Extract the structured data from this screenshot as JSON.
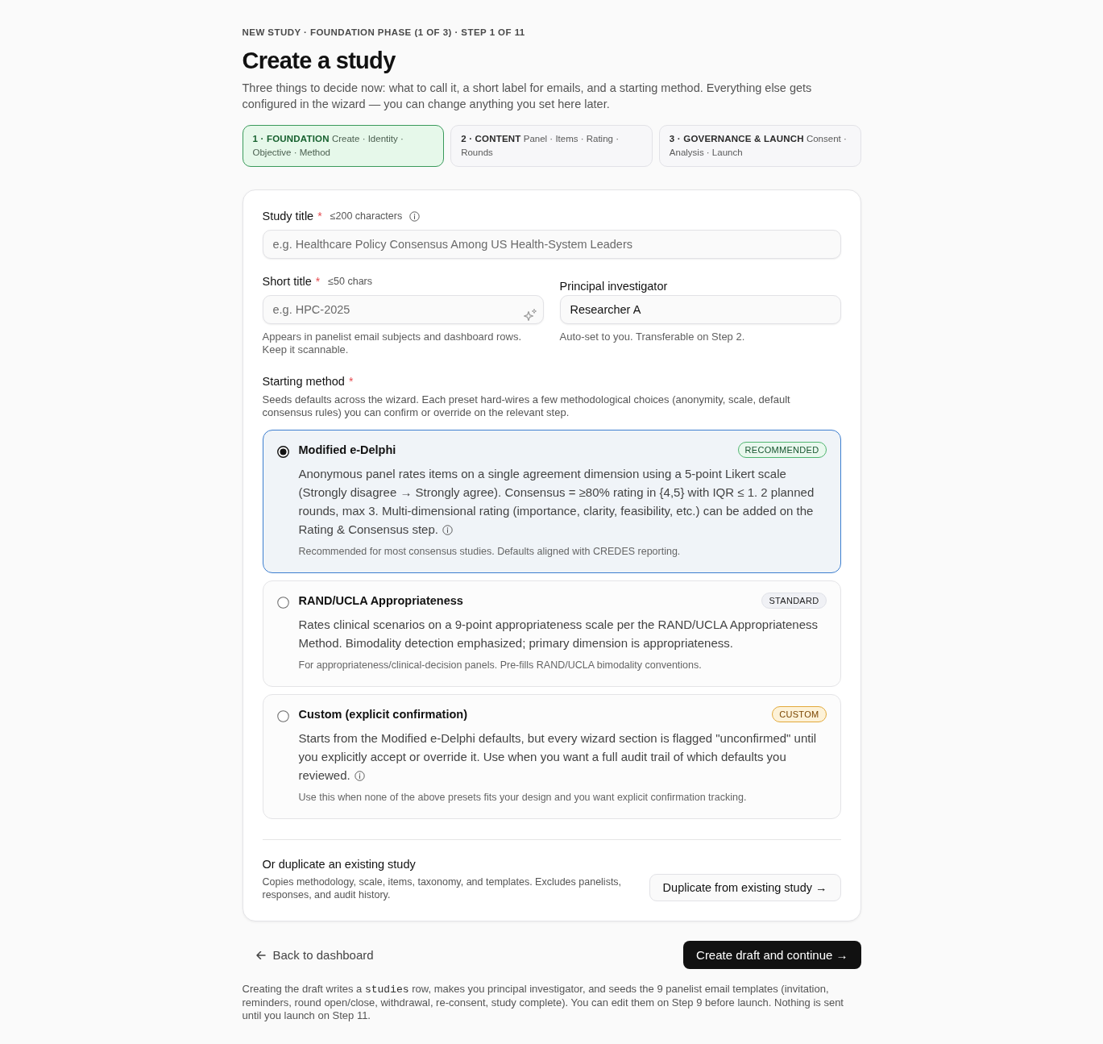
{
  "breadcrumb": "NEW STUDY · FOUNDATION PHASE (1 OF 3) · STEP 1 OF 11",
  "title": "Create a study",
  "intro": "Three things to decide now: what to call it, a short label for emails, and a starting method. Everything else gets configured in the wizard — you can change anything you set here later.",
  "phases": [
    {
      "text": "**1 · FOUNDATION** Create · Identity · Objective · Method",
      "selected": true
    },
    {
      "text": "**2 · CONTENT** Panel · Items · Rating · Rounds",
      "selected": false
    },
    {
      "text": "**3 · GOVERNANCE & LAUNCH** Consent · Analysis · Launch",
      "selected": false
    }
  ],
  "study_title": {
    "label": "Study title",
    "required_mark": "*",
    "hint": "≤200 characters",
    "info": true,
    "placeholder": "e.g. Healthcare Policy Consensus Among US Health-System Leaders"
  },
  "short_title": {
    "label": "Short title",
    "required_mark": "*",
    "hint": "≤50 chars",
    "placeholder": "e.g. HPC-2025",
    "help": "Appears in panelist email subjects and dashboard rows. Keep it scannable."
  },
  "principal_investigator": {
    "label": "Principal investigator",
    "value": "Researcher A",
    "help": "Auto-set to you. Transferable on Step 2."
  },
  "starting_method": {
    "label": "Starting method",
    "required_mark": "*",
    "description": "Seeds defaults across the wizard. Each preset hard-wires a few methodological choices (anonymity, scale, default consensus rules) you can confirm or override on the relevant step.",
    "options": [
      {
        "title": "Modified e-Delphi",
        "badge": {
          "text": "RECOMMENDED",
          "kind": "recommended"
        },
        "description": "Anonymous panel rates items on a single agreement dimension using a 5-point Likert scale (Strongly disagree → Strongly agree). Consensus = ≥80% rating in {4,5} with IQR ≤ 1. 2 planned rounds, max 3. Multi-dimensional rating (importance, clarity, feasibility, etc.) can be added on the Rating & Consensus step.",
        "info": true,
        "note": "Recommended for most consensus studies. Defaults aligned with CREDES reporting.",
        "selected": true
      },
      {
        "title": "RAND/UCLA Appropriateness",
        "badge": {
          "text": "STANDARD",
          "kind": "standard"
        },
        "description": "Rates clinical scenarios on a 9-point appropriateness scale per the RAND/UCLA Appropriateness Method. Bimodality detection emphasized; primary dimension is appropriateness.",
        "info": false,
        "note": "For appropriateness/clinical-decision panels. Pre-fills RAND/UCLA bimodality conventions.",
        "selected": false
      },
      {
        "title": "Custom (explicit confirmation)",
        "badge": {
          "text": "CUSTOM",
          "kind": "custom"
        },
        "description": "Starts from the Modified e-Delphi defaults, but every wizard section is flagged \"unconfirmed\" until you explicitly accept or override it. Use when you want a full audit trail of which defaults you reviewed.",
        "info": true,
        "note": "Use this when none of the above presets fits your design and you want explicit confirmation tracking.",
        "selected": false
      }
    ]
  },
  "duplicate": {
    "heading": "Or duplicate an existing study",
    "description": "Copies methodology, scale, items, taxonomy, and templates. Excludes panelists, responses, and audit history.",
    "button": "Duplicate from existing study →"
  },
  "actions": {
    "back": "Back to dashboard",
    "primary": "Create draft and continue →"
  },
  "footer": [
    {
      "kind": "text",
      "text": "Creating the draft writes a "
    },
    {
      "kind": "code",
      "text": "studies"
    },
    {
      "kind": "text",
      "text": " row, makes you principal investigator, and seeds the 9 panelist email templates (invitation, reminders, round open/close, withdrawal, re-consent, study complete). You can edit them on Step 9 before launch. Nothing is sent until you launch on Step 11."
    }
  ]
}
